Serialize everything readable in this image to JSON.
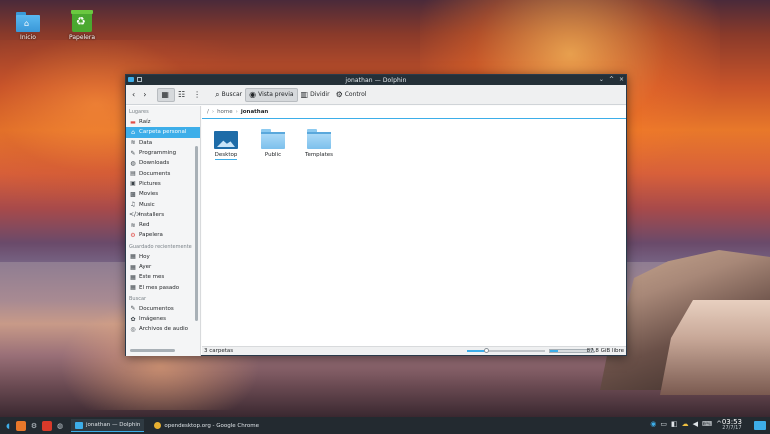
{
  "desktop": {
    "icons": [
      {
        "label": "Inicio",
        "icon": "home-folder-icon"
      },
      {
        "label": "Papelera",
        "icon": "trash-icon"
      }
    ]
  },
  "window": {
    "title": "jonathan — Dolphin",
    "title_parts": {
      "folder": "jonathan",
      "app": "Dolphin"
    },
    "controls": {
      "minimize": "⌄",
      "maximize": "^",
      "close": "×"
    }
  },
  "toolbar": {
    "back": "‹",
    "forward": "›",
    "buscar": "Buscar",
    "vista_previa": "Vista previa",
    "dividir": "Dividir",
    "control": "Control"
  },
  "sidebar": {
    "sections": [
      {
        "heading": "Lugares",
        "items": [
          {
            "label": "Raíz",
            "icon": "folder-red-icon"
          },
          {
            "label": "Carpeta personal",
            "icon": "home-icon",
            "selected": true
          },
          {
            "label": "Data",
            "icon": "network-icon"
          },
          {
            "label": "Programming",
            "icon": "tools-icon"
          },
          {
            "label": "Downloads",
            "icon": "download-icon"
          },
          {
            "label": "Documents",
            "icon": "document-icon"
          },
          {
            "label": "Pictures",
            "icon": "image-icon"
          },
          {
            "label": "Movies",
            "icon": "film-icon"
          },
          {
            "label": "Music",
            "icon": "music-icon"
          },
          {
            "label": "Installers",
            "icon": "code-icon"
          },
          {
            "label": "Red",
            "icon": "wifi-icon"
          },
          {
            "label": "Papelera",
            "icon": "trash-icon"
          }
        ]
      },
      {
        "heading": "Guardado recientemente",
        "items": [
          {
            "label": "Hoy",
            "icon": "calendar-icon"
          },
          {
            "label": "Ayer",
            "icon": "calendar-icon"
          },
          {
            "label": "Este mes",
            "icon": "calendar-icon"
          },
          {
            "label": "El mes pasado",
            "icon": "calendar-icon"
          }
        ]
      },
      {
        "heading": "Buscar",
        "items": [
          {
            "label": "Documentos",
            "icon": "document-icon"
          },
          {
            "label": "Imágenes",
            "icon": "image-icon"
          },
          {
            "label": "Archivos de audio",
            "icon": "music-icon"
          }
        ]
      }
    ]
  },
  "breadcrumb": {
    "root": "/",
    "sep": "›",
    "items": [
      "home",
      "jonathan"
    ]
  },
  "files": [
    {
      "label": "Desktop",
      "type": "desktop-folder"
    },
    {
      "label": "Public",
      "type": "folder"
    },
    {
      "label": "Templates",
      "type": "folder"
    }
  ],
  "statusbar": {
    "count": "3 carpetas",
    "zoom_fraction": 0.25,
    "free_space": "87,8 GiB libre",
    "used_fraction": 0.18
  },
  "taskbar": {
    "tasks": [
      {
        "label": "jonathan — Dolphin",
        "active": true
      },
      {
        "label": "opendesktop.org - Google Chrome",
        "active": false
      }
    ],
    "clock_time": "03:53",
    "clock_date": "27/7/17"
  },
  "colors": {
    "accent": "#3daee9",
    "titlebar": "#243038",
    "taskbar": "#232a30"
  }
}
